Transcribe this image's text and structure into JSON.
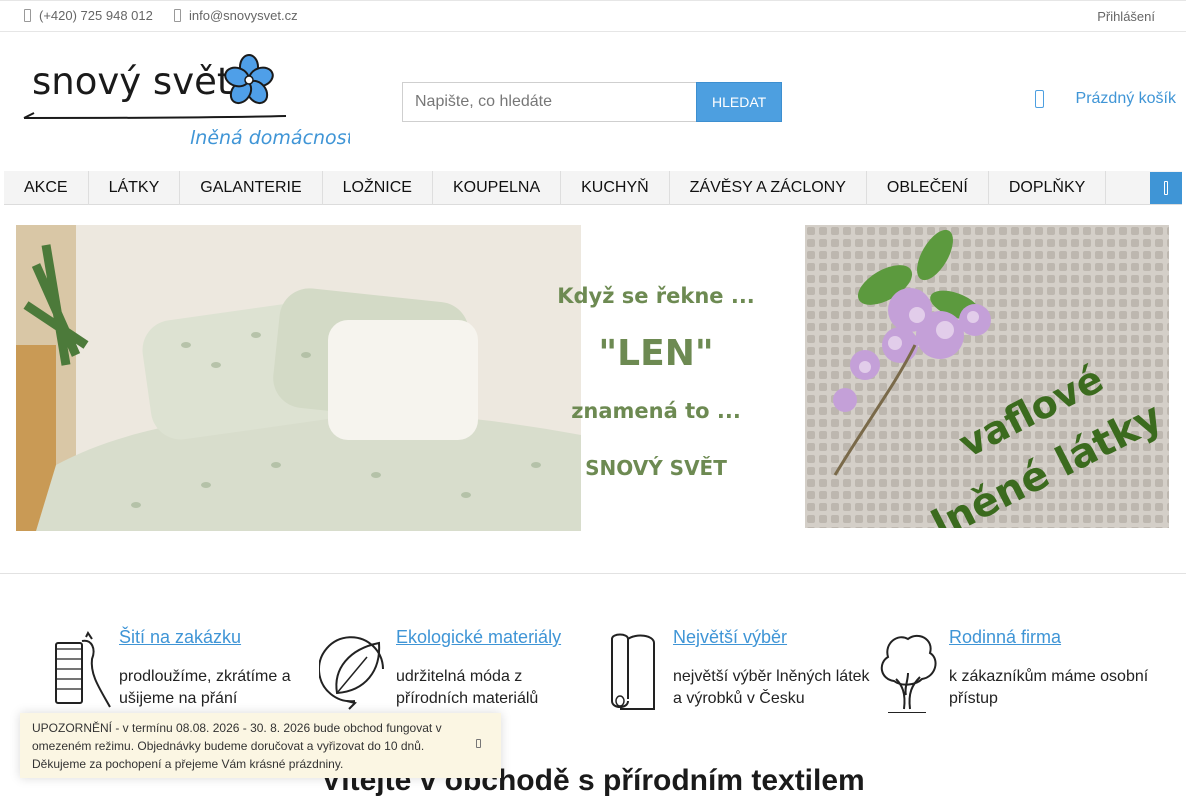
{
  "topbar": {
    "phone": "(+420) 725 948 012",
    "email": "info@snovysvet.cz",
    "login": "Přihlášení"
  },
  "logo": {
    "line1": "snový svět",
    "line2": "lněná domácnost"
  },
  "search": {
    "placeholder": "Napište, co hledáte",
    "button": "HLEDAT"
  },
  "cart": {
    "label": "Prázdný košík"
  },
  "nav": {
    "items": [
      "AKCE",
      "LÁTKY",
      "GALANTERIE",
      "LOŽNICE",
      "KOUPELNA",
      "KUCHYŇ",
      "ZÁVĚSY A ZÁCLONY",
      "OBLEČENÍ",
      "DOPLŇKY"
    ]
  },
  "banners": {
    "left": {
      "line1": "Když se řekne ...",
      "line2": "\"LEN\"",
      "line3": "znamená to ...",
      "line4": "SNOVÝ SVĚT"
    },
    "right": {
      "line1": "vaflové",
      "line2": "lněné látky"
    }
  },
  "features": [
    {
      "title": "Šití na zakázku",
      "desc": "prodloužíme, zkrátíme a ušijeme na přání",
      "icon": "thread-spool-icon"
    },
    {
      "title": "Ekologické materiály",
      "desc": "udržitelná móda z přírodních materiálů",
      "icon": "leaf-icon"
    },
    {
      "title": "Největší výběr",
      "desc": "největší výběr lněných látek a výrobků v Česku",
      "icon": "fabric-roll-icon"
    },
    {
      "title": "Rodinná firma",
      "desc": "k zákazníkům máme osobní přístup",
      "icon": "tree-icon"
    }
  ],
  "notice": {
    "text": "UPOZORNĚNÍ - v termínu 08.08. 2026 - 30. 8. 2026 bude obchod fungovat v omezeném režimu. Objednávky budeme doručovat a vyřizovat do 10 dnů. Děkujeme za pochopení a přejeme Vám krásné prázdniny."
  },
  "headline": "Vítejte v obchodě s přírodním textilem",
  "colors": {
    "accent": "#4d9fe0",
    "link": "#3f95d6",
    "bannerText": "#6d8a52",
    "noticeBg": "#fbf6e3"
  }
}
